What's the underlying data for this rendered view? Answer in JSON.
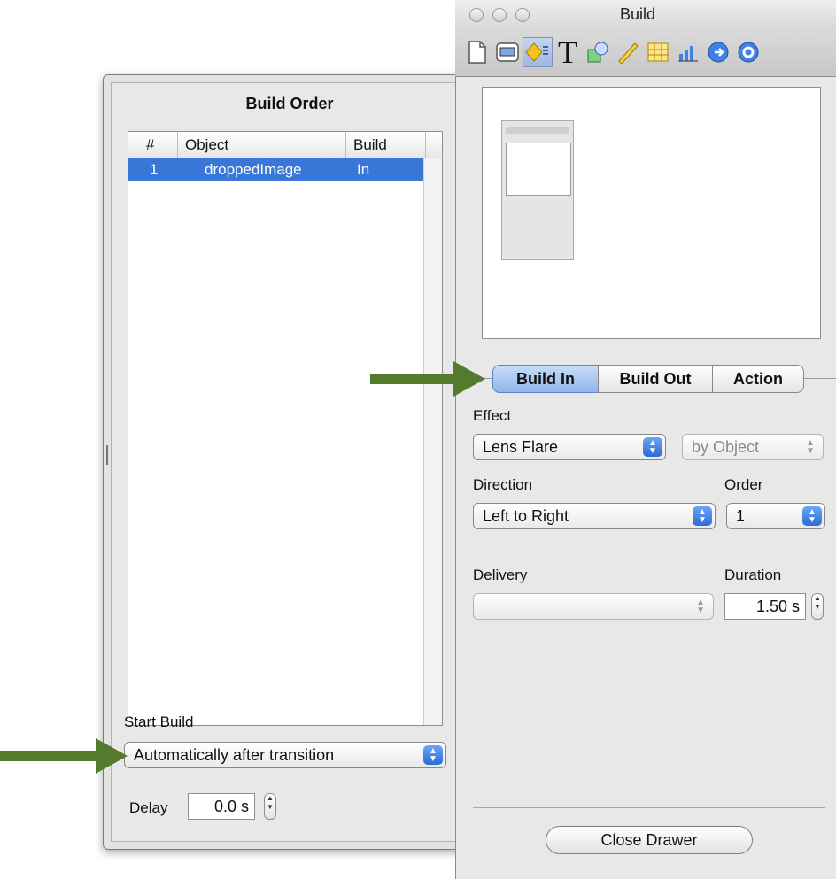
{
  "window": {
    "title": "Build"
  },
  "toolbar": {
    "icons": [
      "document-icon",
      "slide-icon",
      "build-icon",
      "text-icon",
      "graphic-icon",
      "metrics-icon",
      "table-icon",
      "chart-icon",
      "hyperlink-icon",
      "quicktime-icon"
    ],
    "selected": "build-icon"
  },
  "build_order": {
    "title": "Build Order",
    "columns": [
      "#",
      "Object",
      "Build"
    ],
    "rows": [
      {
        "num": "1",
        "object": "droppedImage",
        "build": "In"
      }
    ],
    "start_build_label": "Start Build",
    "start_build_value": "Automatically after transition",
    "delay_label": "Delay",
    "delay_value": "0.0 s"
  },
  "tabs": [
    "Build In",
    "Build Out",
    "Action"
  ],
  "effect": {
    "label": "Effect",
    "value": "Lens Flare",
    "scope_value": "by Object"
  },
  "direction": {
    "label": "Direction",
    "value": "Left to Right"
  },
  "order": {
    "label": "Order",
    "value": "1"
  },
  "delivery": {
    "label": "Delivery",
    "value": ""
  },
  "duration": {
    "label": "Duration",
    "value": "1.50 s"
  },
  "close_drawer_label": "Close Drawer",
  "colors": {
    "selection": "#3876d8",
    "arrow": "#547a2e",
    "popup_accent": "#2d6ad8"
  }
}
